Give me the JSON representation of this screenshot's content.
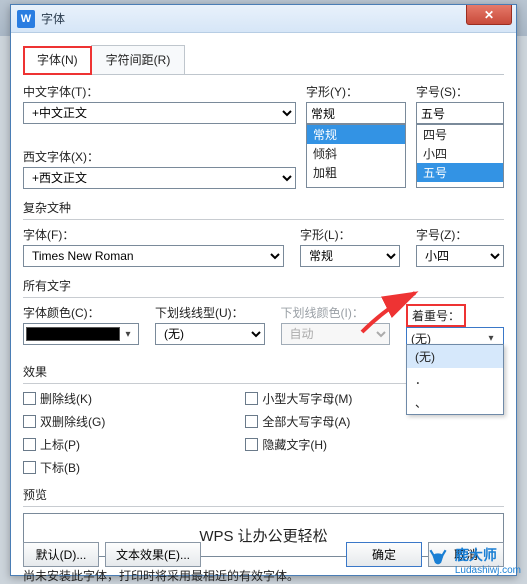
{
  "title": "字体",
  "tabs": {
    "font": "字体(N)",
    "spacing": "字符间距(R)"
  },
  "chinese": {
    "label": "中文字体(T)：",
    "value": "+中文正文"
  },
  "western": {
    "label": "西文字体(X)：",
    "value": "+西文正文"
  },
  "style": {
    "label": "字形(Y)：",
    "value": "常规",
    "options": [
      "常规",
      "倾斜",
      "加粗"
    ]
  },
  "size": {
    "label": "字号(S)：",
    "value": "五号",
    "options": [
      "四号",
      "小四",
      "五号"
    ]
  },
  "complex": {
    "title": "复杂文种",
    "font_label": "字体(F)：",
    "font_value": "Times New Roman",
    "style_label": "字形(L)：",
    "style_value": "常规",
    "size_label": "字号(Z)：",
    "size_value": "小四"
  },
  "alltext": {
    "title": "所有文字",
    "color_label": "字体颜色(C)：",
    "underline_label": "下划线线型(U)：",
    "underline_value": "(无)",
    "underline_color_label": "下划线颜色(I)：",
    "underline_color_value": "自动",
    "emphasis_label": "着重号：",
    "emphasis_value": "(无)",
    "emphasis_options": [
      "(无)",
      "．",
      "、"
    ]
  },
  "effects": {
    "title": "效果",
    "left": [
      "删除线(K)",
      "双删除线(G)",
      "上标(P)",
      "下标(B)"
    ],
    "right": [
      "小型大写字母(M)",
      "全部大写字母(A)",
      "隐藏文字(H)"
    ]
  },
  "preview": {
    "title": "预览",
    "text": "WPS 让办公更轻松"
  },
  "note": "尚未安装此字体，打印时将采用最相近的有效字体。",
  "footer": {
    "default": "默认(D)...",
    "text_effect": "文本效果(E)...",
    "ok": "确定",
    "cancel": "取消"
  },
  "watermark": {
    "brand": "鹿大师",
    "url": "Ludashiwj.com"
  }
}
